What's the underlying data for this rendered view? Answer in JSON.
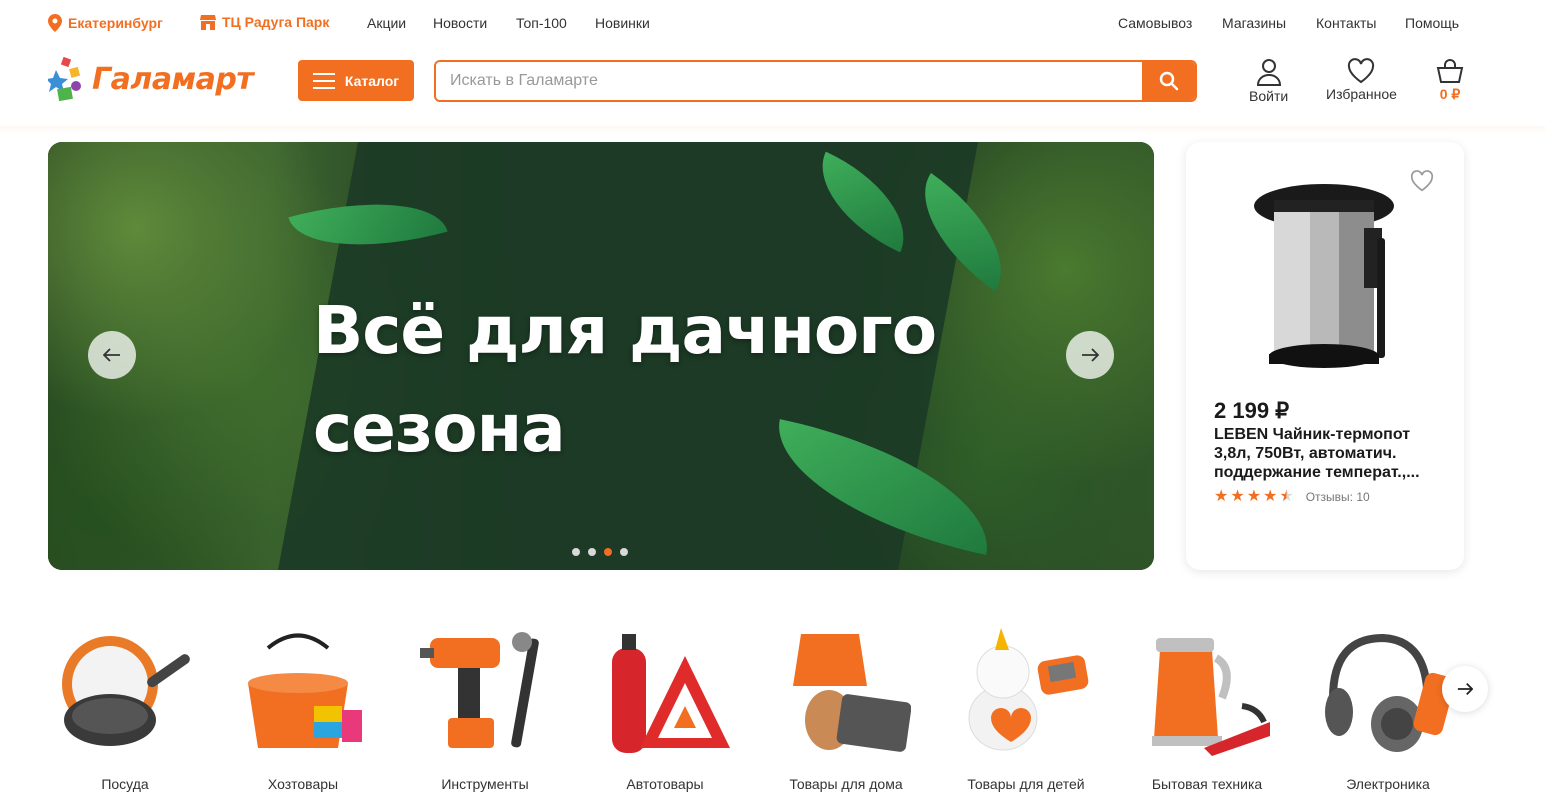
{
  "topbar": {
    "city": "Екатеринбург",
    "store": "ТЦ Радуга Парк",
    "nav_left": [
      "Акции",
      "Новости",
      "Топ-100",
      "Новинки"
    ],
    "nav_right": [
      "Самовывоз",
      "Магазины",
      "Контакты",
      "Помощь"
    ]
  },
  "header": {
    "logo_text": "Галамарт",
    "catalog_label": "Каталог",
    "search_placeholder": "Искать в Галамарте",
    "search_value": "",
    "login_label": "Войти",
    "favorites_label": "Избранное",
    "cart_total": "0 ₽"
  },
  "banner": {
    "headline": "Всё для дачного сезона",
    "slides_total": 4,
    "active_slide": 3
  },
  "product": {
    "price": "2 199 ₽",
    "name": "LEBEN Чайник-термопот 3,8л, 750Вт, автоматич. поддержание температ.,...",
    "rating": 4.5,
    "reviews": "Отзывы: 10"
  },
  "categories": [
    {
      "label": "Посуда",
      "icon": "frying-pan-icon"
    },
    {
      "label": "Хозтовары",
      "icon": "bucket-icon"
    },
    {
      "label": "Инструменты",
      "icon": "drill-icon"
    },
    {
      "label": "Автотовары",
      "icon": "fire-extinguisher-icon"
    },
    {
      "label": "Товары для дома",
      "icon": "lamp-icon"
    },
    {
      "label": "Товары для детей",
      "icon": "toy-unicorn-icon"
    },
    {
      "label": "Бытовая техника",
      "icon": "kettle-icon"
    },
    {
      "label": "Электроника",
      "icon": "headphones-icon"
    }
  ],
  "colors": {
    "accent": "#f26f21",
    "text": "#333333",
    "banner_dark": "#1c3b26"
  }
}
